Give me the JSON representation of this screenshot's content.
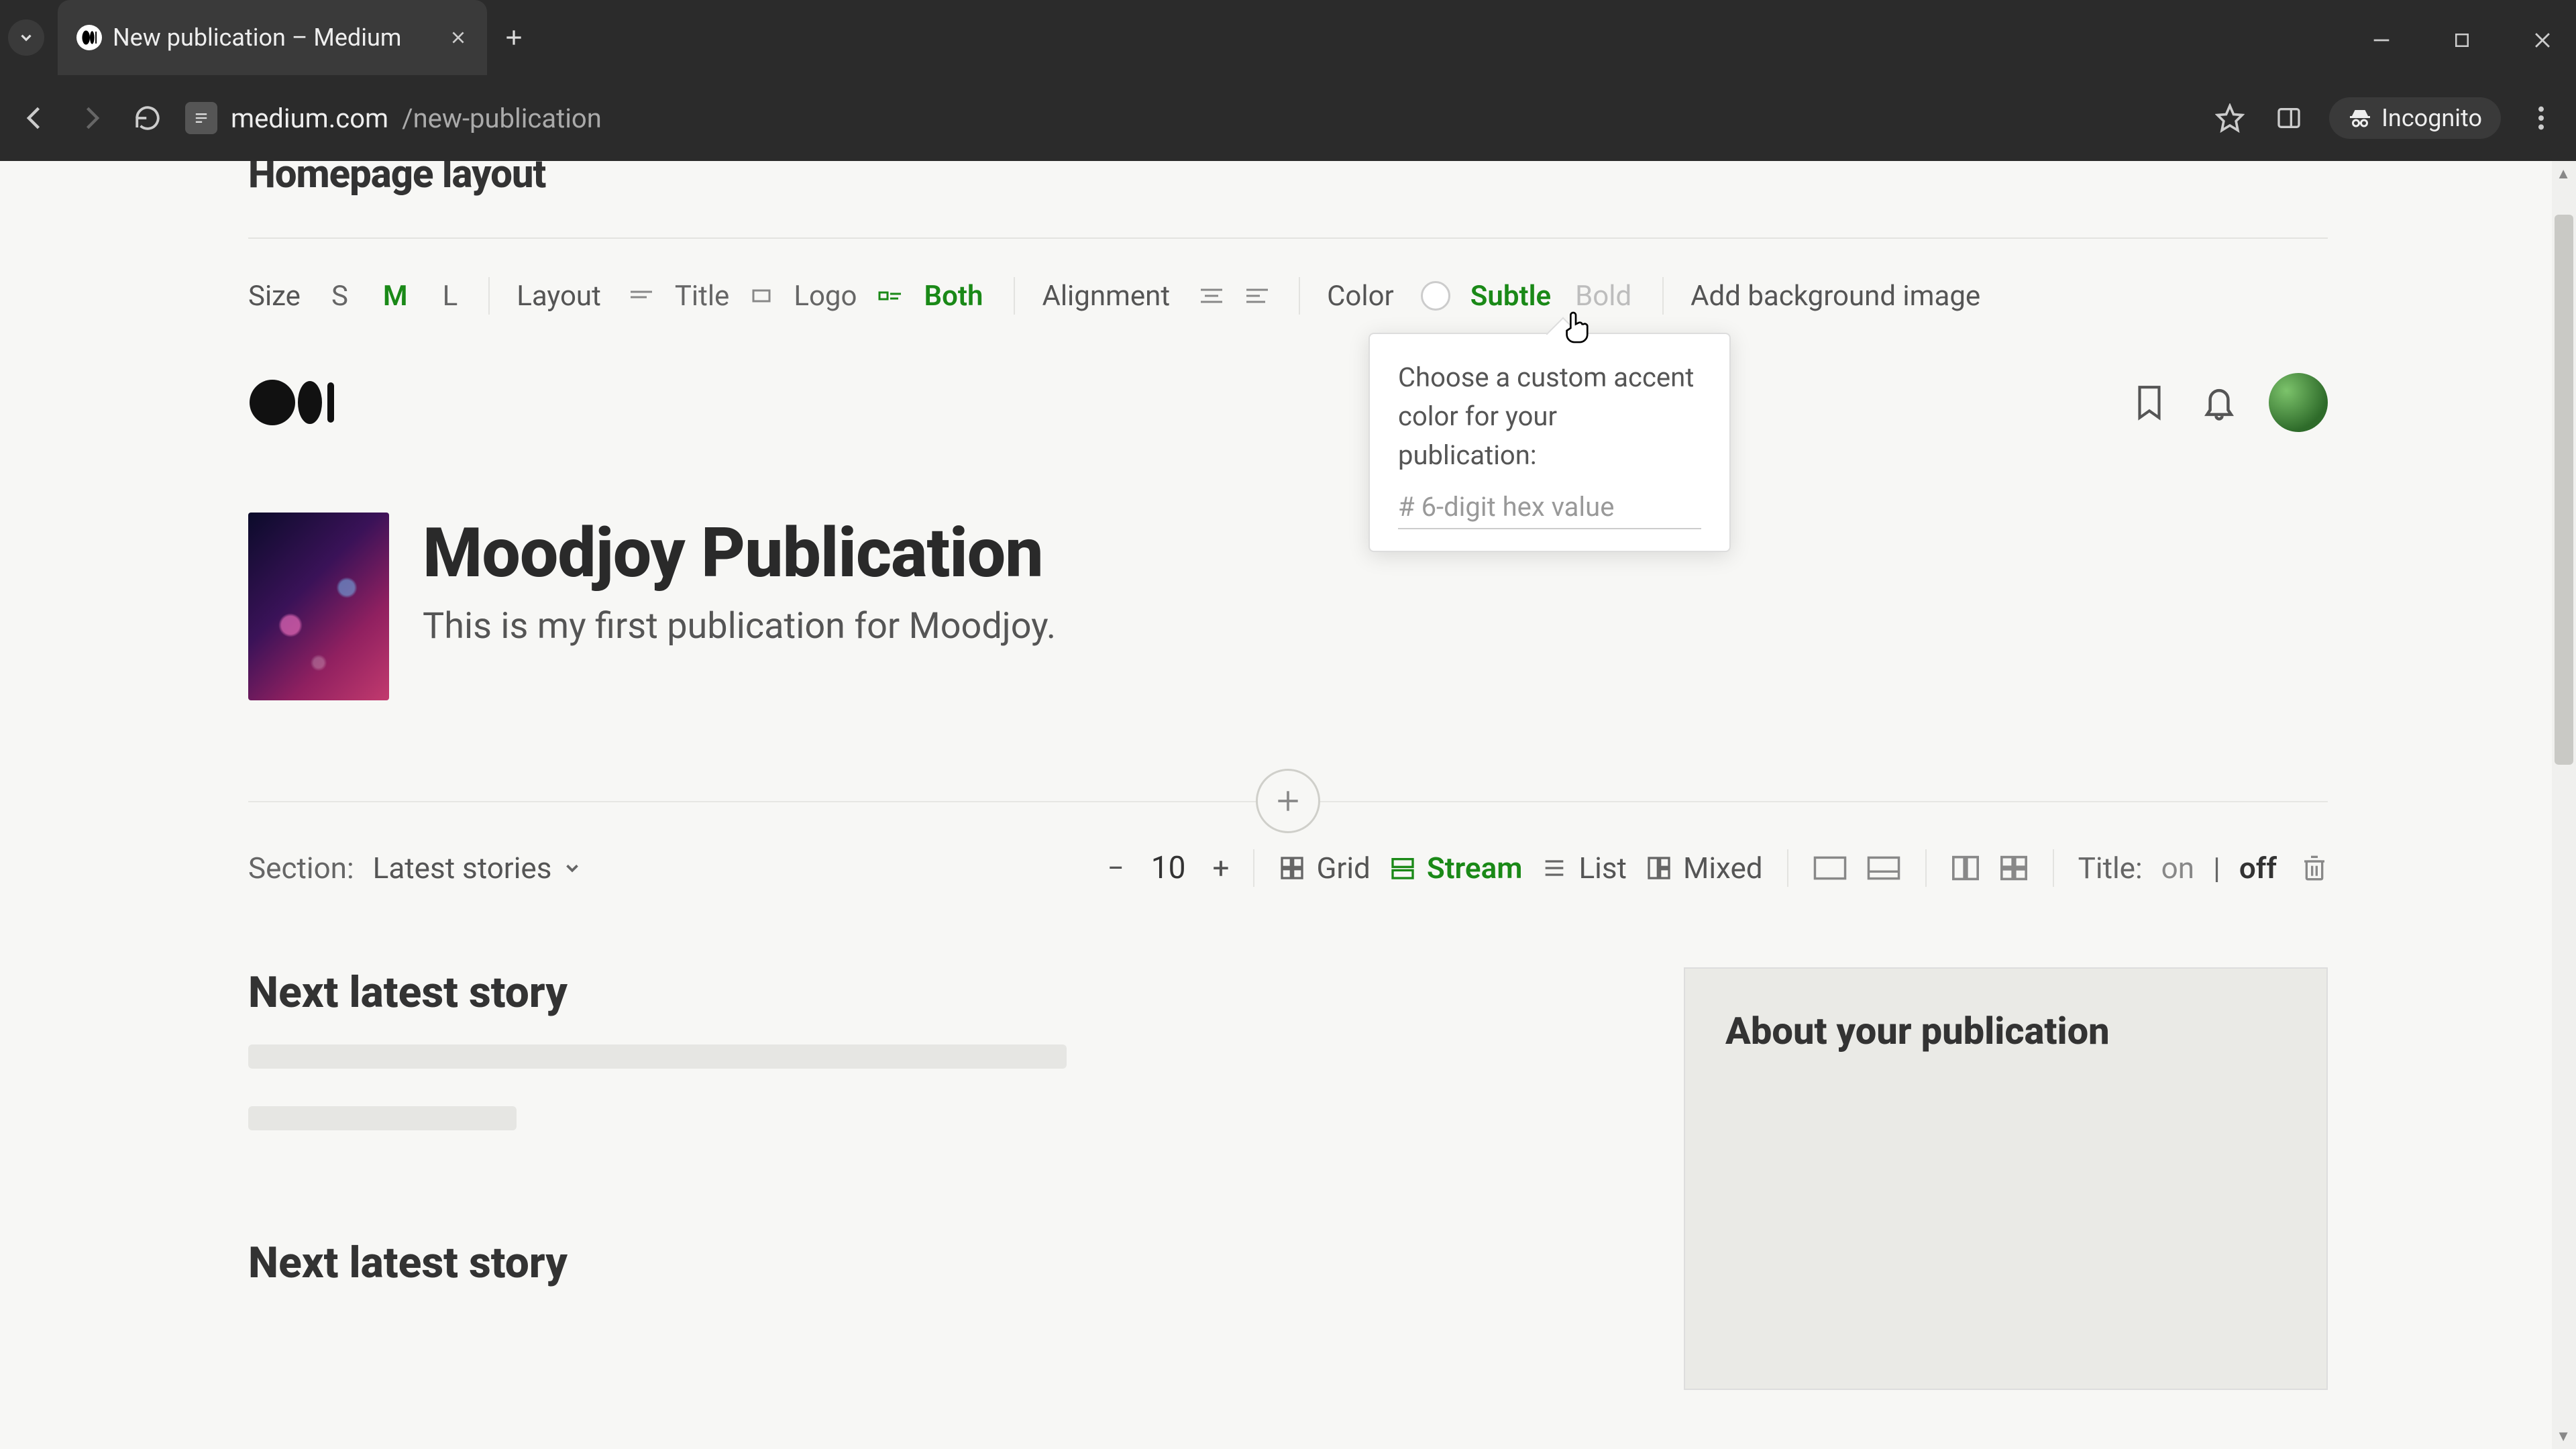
{
  "browser": {
    "tab_title": "New publication – Medium",
    "url_host": "medium.com",
    "url_path": "/new-publication",
    "incognito_label": "Incognito"
  },
  "page": {
    "headline": "Homepage layout",
    "toolbar": {
      "size_label": "Size",
      "size_options": [
        "S",
        "M",
        "L"
      ],
      "size_active": "M",
      "layout_label": "Layout",
      "layout_options": {
        "title": "Title",
        "logo": "Logo",
        "both": "Both"
      },
      "layout_active": "Both",
      "alignment_label": "Alignment",
      "color_label": "Color",
      "color_options": {
        "subtle": "Subtle",
        "bold": "Bold"
      },
      "color_active": "Subtle",
      "bg_link": "Add background image"
    },
    "color_popover": {
      "text": "Choose a custom accent color for your publication:",
      "hex_prefix": "# ",
      "hex_placeholder": "6-digit hex value"
    },
    "publication": {
      "title": "Moodjoy Publication",
      "description": "This is my first publication for Moodjoy."
    },
    "section_controls": {
      "section_label": "Section:",
      "section_value": "Latest stories",
      "count": "10",
      "layouts": {
        "grid": "Grid",
        "stream": "Stream",
        "list": "List",
        "mixed": "Mixed"
      },
      "layout_active": "Stream",
      "title_label": "Title:",
      "title_on": "on",
      "title_sep": "|",
      "title_off": "off"
    },
    "preview": {
      "story_title": "Next latest story",
      "about_title": "About your publication"
    },
    "colors": {
      "accent": "#1a8917"
    }
  }
}
